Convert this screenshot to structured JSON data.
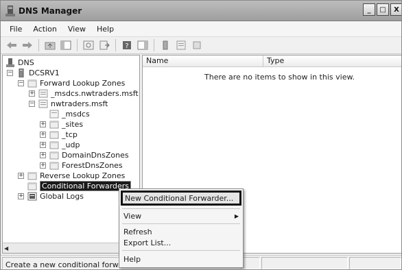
{
  "window": {
    "title": "DNS Manager",
    "controls": {
      "minimize": "_",
      "maximize": "□",
      "close": "X"
    }
  },
  "menubar": {
    "items": [
      "File",
      "Action",
      "View",
      "Help"
    ]
  },
  "toolbar": {
    "icons": [
      "back-arrow-icon",
      "forward-arrow-icon",
      "up-folder-icon",
      "show-hide-tree-icon",
      "refresh-icon",
      "export-list-icon",
      "help-icon",
      "show-hide-action-pane-icon",
      "server-icon",
      "zone-icon",
      "record-icon"
    ]
  },
  "tree": {
    "root": "DNS",
    "server": "DCSRV1",
    "forward_zones": "Forward Lookup Zones",
    "msdcs_zone": "_msdcs.nwtraders.msft",
    "nwtraders_zone": "nwtraders.msft",
    "children": [
      "_msdcs",
      "_sites",
      "_tcp",
      "_udp",
      "DomainDnsZones",
      "ForestDnsZones"
    ],
    "reverse_zones": "Reverse Lookup Zones",
    "conditional_forwarders": "Conditional Forwarders",
    "global_logs": "Global Logs",
    "expanders": {
      "collapse": "−",
      "expand": "+"
    }
  },
  "result_pane": {
    "columns": [
      "Name",
      "Type"
    ],
    "empty_message": "There are no items to show in this view."
  },
  "context_menu": {
    "new_conditional_forwarder": "New Conditional Forwarder...",
    "view": "View",
    "refresh": "Refresh",
    "export_list": "Export List...",
    "help": "Help"
  },
  "statusbar": {
    "text": "Create a new conditional forwarder"
  }
}
